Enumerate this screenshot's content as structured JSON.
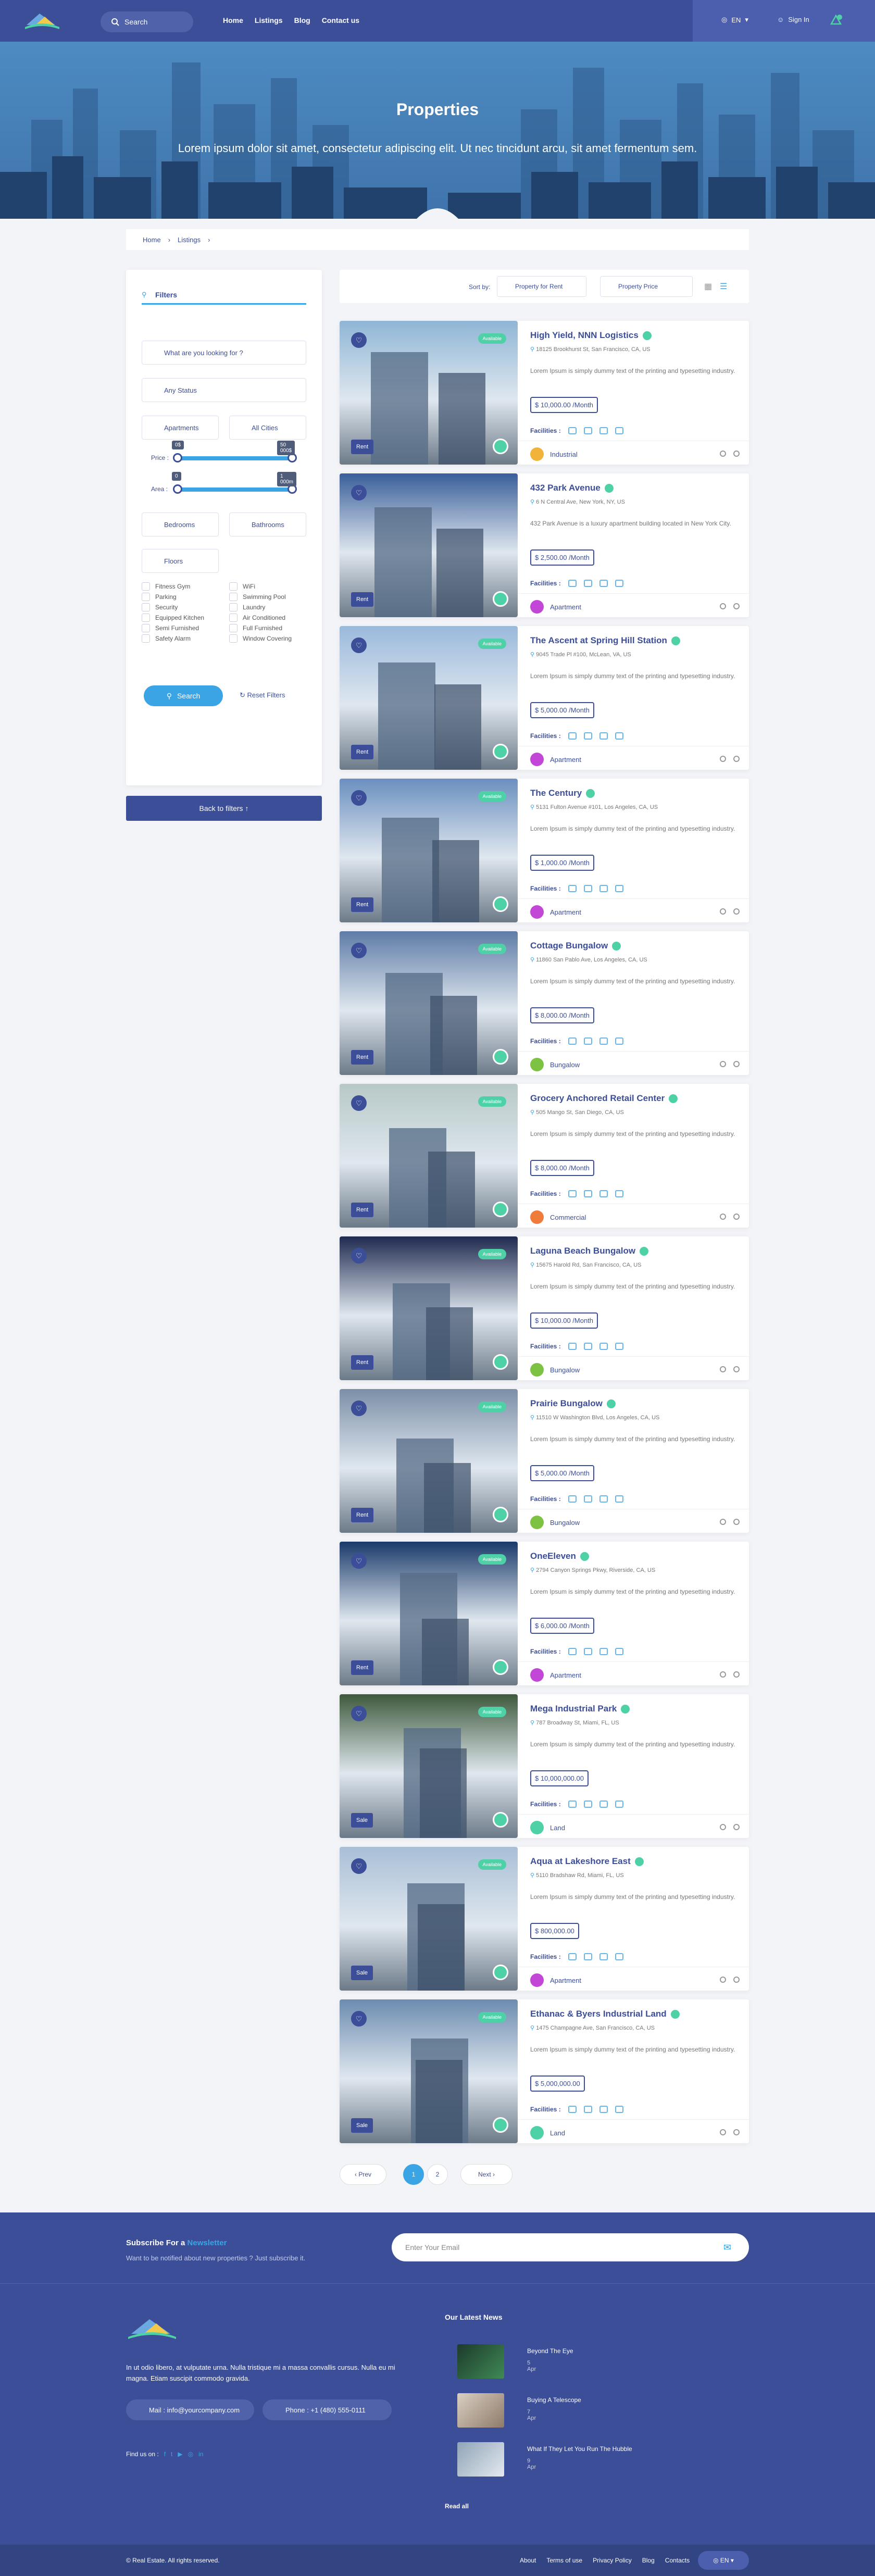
{
  "header": {
    "search_label": "Search",
    "nav": [
      "Home",
      "Listings",
      "Blog",
      "Contact us"
    ],
    "lang": "EN",
    "signin": "Sign In"
  },
  "hero": {
    "title": "Properties",
    "subtitle": "Lorem ipsum dolor sit amet, consectetur adipiscing elit. Ut nec tincidunt arcu, sit amet fermentum sem."
  },
  "breadcrumb": [
    "Home",
    "Listings"
  ],
  "filters": {
    "title": "Filters",
    "keyword_placeholder": "What are you looking for ?",
    "status": "Any Status",
    "type": "Apartments",
    "city": "All Cities",
    "price_label": "Price :",
    "area_label": "Area :",
    "price_min": "0$",
    "price_max": "50 000$",
    "area_min": "0",
    "area_max": "1 000m",
    "bedrooms": "Bedrooms",
    "bathrooms": "Bathrooms",
    "floors": "Floors",
    "checks_left": [
      "Fitness Gym",
      "Parking",
      "Security",
      "Equipped Kitchen",
      "Semi Furnished",
      "Safety Alarm"
    ],
    "checks_right": [
      "WiFi",
      "Swimming Pool",
      "Laundry",
      "Air Conditioned",
      "Full Furnished",
      "Window Covering"
    ],
    "search_btn": "Search",
    "reset": "Reset Filters",
    "back": "Back to filters"
  },
  "sort": {
    "label": "Sort by:",
    "opt1": "Property for Rent",
    "opt2": "Property Price"
  },
  "listings": [
    {
      "title": "High Yield, NNN Logistics",
      "address": "18125 Brookhurst St, San Francisco, CA, US",
      "desc": "Lorem Ipsum is simply dummy text of the printing and typesetting industry.",
      "price": "$ 10,000.00 /Month",
      "category": "Industrial",
      "deal": "Rent",
      "available": "Available"
    },
    {
      "title": "432 Park Avenue",
      "address": "6 N Central Ave, New York, NY, US",
      "desc": "432 Park Avenue is a luxury apartment building located in New York City.",
      "price": "$ 2,500.00 /Month",
      "category": "Apartment",
      "deal": "Rent",
      "available": ""
    },
    {
      "title": "The Ascent at Spring Hill Station",
      "address": "9045 Trade Pl #100, McLean, VA, US",
      "desc": "Lorem Ipsum is simply dummy text of the printing and typesetting industry.",
      "price": "$ 5,000.00 /Month",
      "category": "Apartment",
      "deal": "Rent",
      "available": "Available"
    },
    {
      "title": "The Century",
      "address": "5131 Fulton Avenue #101, Los Angeles, CA, US",
      "desc": "Lorem Ipsum is simply dummy text of the printing and typesetting industry.",
      "price": "$ 1,000.00 /Month",
      "category": "Apartment",
      "deal": "Rent",
      "available": "Available"
    },
    {
      "title": "Cottage Bungalow",
      "address": "11860 San Pablo Ave, Los Angeles, CA, US",
      "desc": "Lorem Ipsum is simply dummy text of the printing and typesetting industry.",
      "price": "$ 8,000.00 /Month",
      "category": "Bungalow",
      "deal": "Rent",
      "available": "Available"
    },
    {
      "title": "Grocery Anchored Retail Center",
      "address": "505 Mango St, San Diego, CA, US",
      "desc": "Lorem Ipsum is simply dummy text of the printing and typesetting industry.",
      "price": "$ 8,000.00 /Month",
      "category": "Commercial",
      "deal": "Rent",
      "available": "Available"
    },
    {
      "title": "Laguna Beach Bungalow",
      "address": "15675 Harold Rd, San Francisco, CA, US",
      "desc": "Lorem Ipsum is simply dummy text of the printing and typesetting industry.",
      "price": "$ 10,000.00 /Month",
      "category": "Bungalow",
      "deal": "Rent",
      "available": "Available"
    },
    {
      "title": "Prairie Bungalow",
      "address": "11510 W Washington Blvd, Los Angeles, CA, US",
      "desc": "Lorem Ipsum is simply dummy text of the printing and typesetting industry.",
      "price": "$ 5,000.00 /Month",
      "category": "Bungalow",
      "deal": "Rent",
      "available": "Available"
    },
    {
      "title": "OneEleven",
      "address": "2794 Canyon Springs Pkwy, Riverside, CA, US",
      "desc": "Lorem Ipsum is simply dummy text of the printing and typesetting industry.",
      "price": "$ 6,000.00 /Month",
      "category": "Apartment",
      "deal": "Rent",
      "available": "Available"
    },
    {
      "title": "Mega Industrial Park",
      "address": "787 Broadway St, Miami, FL, US",
      "desc": "Lorem Ipsum is simply dummy text of the printing and typesetting industry.",
      "price": "$ 10,000,000.00",
      "category": "Land",
      "deal": "Sale",
      "available": "Available"
    },
    {
      "title": "Aqua at Lakeshore East",
      "address": "5110 Bradshaw Rd, Miami, FL, US",
      "desc": "Lorem Ipsum is simply dummy text of the printing and typesetting industry.",
      "price": "$ 800,000.00",
      "category": "Apartment",
      "deal": "Sale",
      "available": "Available"
    },
    {
      "title": "Ethanac & Byers Industrial Land",
      "address": "1475 Champagne Ave, San Francisco, CA, US",
      "desc": "Lorem Ipsum is simply dummy text of the printing and typesetting industry.",
      "price": "$ 5,000,000.00",
      "category": "Land",
      "deal": "Sale",
      "available": "Available"
    }
  ],
  "facilities_label": "Facilities :",
  "pagination": {
    "prev": "Prev",
    "p1": "1",
    "p2": "2",
    "next": "Next"
  },
  "newsletter": {
    "title": "Subscribe For a ",
    "accent": "Newsletter",
    "sub": "Want to be notified about new properties ? Just subscribe it.",
    "placeholder": "Enter Your Email"
  },
  "footer": {
    "about": "In ut odio libero, at vulputate urna. Nulla tristique mi a massa convallis cursus. Nulla eu mi magna. Etiam suscipit commodo gravida.",
    "mail": "Mail : info@yourcompany.com",
    "phone": "Phone : +1 (480) 555-0111",
    "find": "Find us on :",
    "latest": "Our Latest News",
    "news": [
      {
        "t": "Beyond The Eye",
        "d": "5 Apr"
      },
      {
        "t": "Buying A Telescope",
        "d": "7 Apr"
      },
      {
        "t": "What If They Let You Run The Hubble",
        "d": "9 Apr"
      }
    ],
    "read_all": "Read all",
    "copy": "© Real Estate. All rights reserved.",
    "links": [
      "About",
      "Terms of use",
      "Privacy Policy",
      "Blog",
      "Contacts"
    ],
    "lang": "EN"
  },
  "colors": {
    "primary": "#3c4e98",
    "accent": "#3aa4e4",
    "green": "#4fd1a7"
  }
}
